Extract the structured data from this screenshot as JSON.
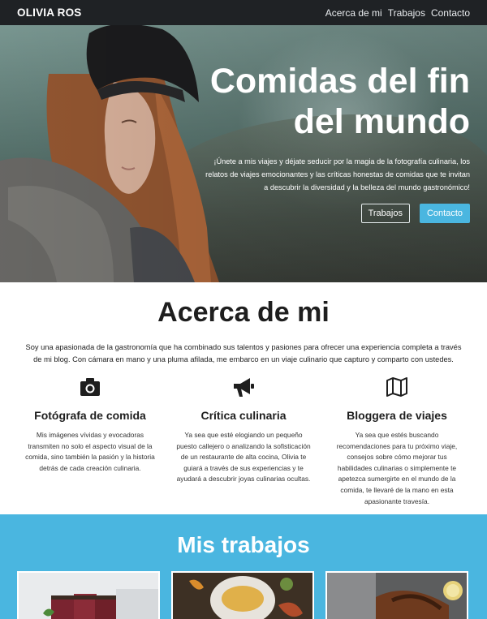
{
  "nav": {
    "brand": "OLIVIA ROS",
    "links": [
      "Acerca de mi",
      "Trabajos",
      "Contacto"
    ]
  },
  "hero": {
    "title": "Comidas del fin del mundo",
    "text": "¡Únete a mis viajes y déjate seducir por la magia de la fotografía culinaria, los relatos de viajes emocionantes y las críticas honestas de comidas que te invitan a descubrir la diversidad y la belleza del mundo gastronómico!",
    "button_secondary": "Trabajos",
    "button_primary": "Contacto"
  },
  "about": {
    "title": "Acerca de mi",
    "intro": "Soy una apasionada de la gastronomía que ha combinado sus talentos y pasiones para ofrecer una experiencia completa a través de mi blog. Con cámara en mano y una pluma afilada, me embarco en un viaje culinario que capturo y comparto con ustedes.",
    "features": [
      {
        "icon": "camera-icon",
        "title": "Fotógrafa de comida",
        "text": "Mis imágenes vívidas y evocadoras transmiten no solo el aspecto visual de la comida, sino también la pasión y la historia detrás de cada creación culinaria."
      },
      {
        "icon": "megaphone-icon",
        "title": "Crítica culinaria",
        "text": "Ya sea que esté elogiando un pequeño puesto callejero o analizando la sofisticación de un restaurante de alta cocina, Olivia te guiará a través de sus experiencias y te ayudará a descubrir joyas culinarias ocultas."
      },
      {
        "icon": "map-icon",
        "title": "Bloggera de viajes",
        "text": "Ya sea que estés buscando recomendaciones para tu próximo viaje, consejos sobre cómo mejorar tus habilidades culinarias o simplemente te apetezca sumergirte en el mundo de la comida, te llevaré de la mano en esta apasionante travesía."
      }
    ]
  },
  "works": {
    "title": "Mis trabajos"
  },
  "colors": {
    "navbar": "#1f2225",
    "accent": "#4ab6e0"
  }
}
